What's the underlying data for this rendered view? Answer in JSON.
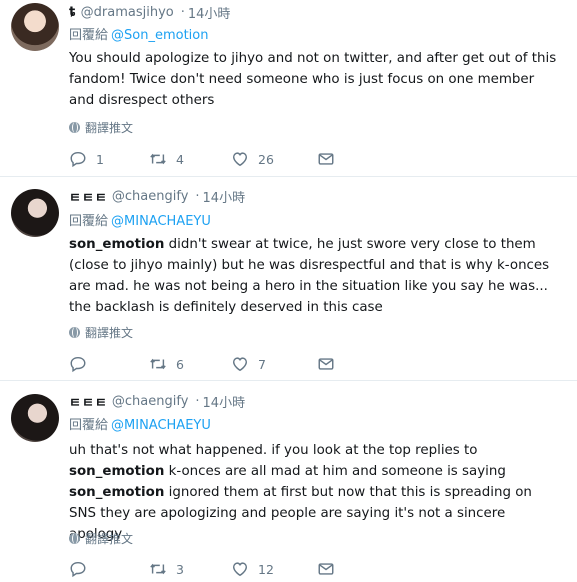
{
  "tweets": [
    {
      "display_name": "ȶ",
      "handle": "@dramasjihyo",
      "dot": "·",
      "time": "14小時",
      "reply_prefix": "回覆給",
      "reply_to": "@Son_emotion",
      "text": "You should apologize to jihyo and not on twitter, and after get out of this fandom! Twice don't need someone who is just focus on one member and disrespect others",
      "translate_label": "翻譯推文",
      "reply_count": "1",
      "retweet_count": "4",
      "like_count": "26"
    },
    {
      "display_name": "ㅌㅌㅌ",
      "handle": "@chaengify",
      "dot": "·",
      "time": "14小時",
      "reply_prefix": "回覆給",
      "reply_to": "@MINACHAEYU",
      "text_mention": "son_emotion",
      "text_rest": " didn't swear at twice, he just swore very close to them (close to jihyo mainly) but he was disrespectful and that is why k-onces are mad. he was not being a hero in the situation like you say he was... the backlash is definitely deserved in this case",
      "translate_label": "翻譯推文",
      "reply_count": "",
      "retweet_count": "6",
      "like_count": "7"
    },
    {
      "display_name": "ㅌㅌㅌ",
      "handle": "@chaengify",
      "dot": "·",
      "time": "14小時",
      "reply_prefix": "回覆給",
      "reply_to": "@MINACHAEYU",
      "text_a": "uh that's not what happened. if you look at the top replies to ",
      "text_mention_1": "son_emotion",
      "text_b": " k-onces are all mad at him and someone is saying ",
      "text_mention_2": "son_emotion",
      "text_c": " ignored them at first but now that this is spreading on SNS they are apologizing and people are saying it's not a sincere apology",
      "translate_label": "翻譯推文",
      "reply_count": "",
      "retweet_count": "3",
      "like_count": "12"
    }
  ],
  "colors": {
    "link": "#1da1f2",
    "muted": "#657786",
    "text": "#14171a",
    "divider": "#e6ecf0"
  },
  "icons": [
    "reply-icon",
    "retweet-icon",
    "like-icon",
    "message-icon",
    "globe-icon"
  ]
}
